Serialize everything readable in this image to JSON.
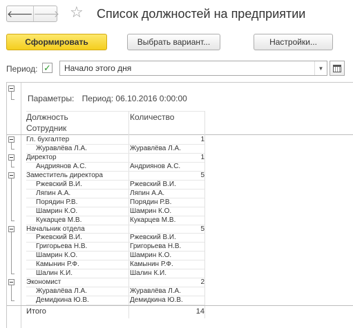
{
  "window": {
    "title": "Список должностей на предприятии"
  },
  "toolbar": {
    "generate_label": "Сформировать",
    "choose_variant_label": "Выбрать вариант...",
    "settings_label": "Настройки..."
  },
  "period": {
    "label": "Период:",
    "checked_mark": "✓",
    "value": "Начало этого дня"
  },
  "report": {
    "params_label": "Параметры:",
    "params_value": "Период: 06.10.2016 0:00:00",
    "col_position": "Должность",
    "col_count": "Количество",
    "col_employee": "Сотрудник",
    "groups": [
      {
        "name": "Гл. бухгалтер",
        "count": "1",
        "employees": [
          [
            "Журавлёва Л.А.",
            "Журавлёва Л.А."
          ]
        ]
      },
      {
        "name": "Директор",
        "count": "1",
        "employees": [
          [
            "Андриянов А.С.",
            "Андриянов А.С."
          ]
        ]
      },
      {
        "name": "Заместитель директора",
        "count": "5",
        "employees": [
          [
            "Ржевский В.И.",
            "Ржевский В.И."
          ],
          [
            "Ляпин А.А.",
            "Ляпин А.А."
          ],
          [
            "Порядин Р.В.",
            "Порядин Р.В."
          ],
          [
            "Шамрин К.О.",
            "Шамрин К.О."
          ],
          [
            "Кукарцев М.В.",
            "Кукарцев М.В."
          ]
        ]
      },
      {
        "name": "Начальник отдела",
        "count": "5",
        "employees": [
          [
            "Ржевский В.И.",
            "Ржевский В.И."
          ],
          [
            "Григорьева Н.В.",
            "Григорьева Н.В."
          ],
          [
            "Шамрин К.О.",
            "Шамрин К.О."
          ],
          [
            "Камынин Р.Ф.",
            "Камынин Р.Ф."
          ],
          [
            "Шалин К.И.",
            "Шалин К.И."
          ]
        ]
      },
      {
        "name": "Экономист",
        "count": "2",
        "employees": [
          [
            "Журавлёва Л.А.",
            "Журавлёва Л.А."
          ],
          [
            "Демидкина Ю.В.",
            "Демидкина Ю.В."
          ]
        ]
      }
    ],
    "total_label": "Итого",
    "total_count": "14"
  }
}
